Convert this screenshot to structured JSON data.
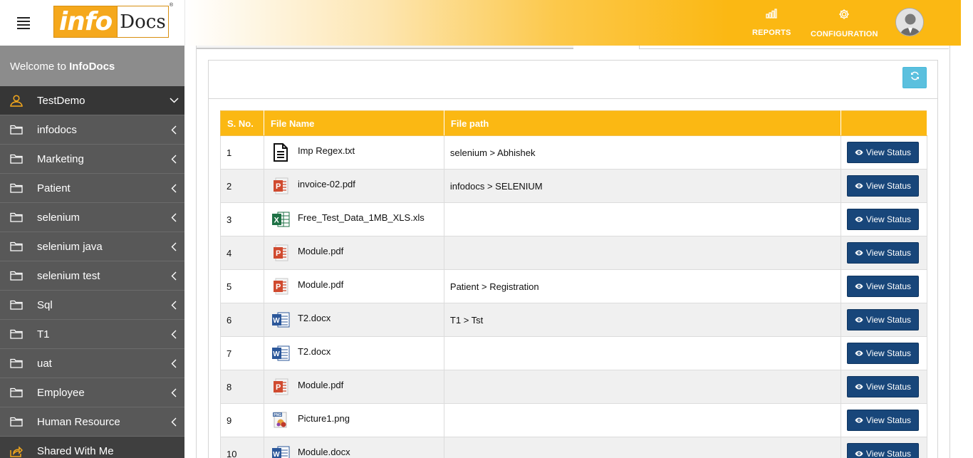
{
  "header": {
    "logo_info": "info",
    "logo_docs": "Docs",
    "logo_reg": "®",
    "reports_label": "REPORTS",
    "config_label": "CONFIGURATION"
  },
  "sidebar": {
    "welcome_prefix": "Welcome to ",
    "welcome_brand": "InfoDocs",
    "items": [
      {
        "label": "TestDemo",
        "icon": "user-icon"
      },
      {
        "label": "infodocs",
        "icon": "folder-icon"
      },
      {
        "label": "Marketing",
        "icon": "folder-icon"
      },
      {
        "label": "Patient",
        "icon": "folder-icon"
      },
      {
        "label": "selenium",
        "icon": "folder-icon"
      },
      {
        "label": "selenium java",
        "icon": "folder-icon"
      },
      {
        "label": "selenium test",
        "icon": "folder-icon"
      },
      {
        "label": "Sql",
        "icon": "folder-icon"
      },
      {
        "label": "T1",
        "icon": "folder-icon"
      },
      {
        "label": "uat",
        "icon": "folder-icon"
      },
      {
        "label": "Employee",
        "icon": "folder-icon"
      },
      {
        "label": "Human Resource",
        "icon": "folder-icon"
      },
      {
        "label": "Shared With Me",
        "icon": "share-icon"
      }
    ]
  },
  "table": {
    "headers": [
      "S. No.",
      "File Name",
      "File path",
      ""
    ],
    "action_label": "View Status",
    "rows": [
      {
        "no": "1",
        "name": "Imp Regex.txt",
        "type": "txt",
        "path": "selenium > Abhishek"
      },
      {
        "no": "2",
        "name": "invoice-02.pdf",
        "type": "pdf",
        "path": "infodocs > SELENIUM"
      },
      {
        "no": "3",
        "name": "Free_Test_Data_1MB_XLS.xls",
        "type": "xls",
        "path": ""
      },
      {
        "no": "4",
        "name": "Module.pdf",
        "type": "pdf",
        "path": ""
      },
      {
        "no": "5",
        "name": "Module.pdf",
        "type": "pdf",
        "path": "Patient > Registration"
      },
      {
        "no": "6",
        "name": "T2.docx",
        "type": "docx",
        "path": "T1 > Tst"
      },
      {
        "no": "7",
        "name": "T2.docx",
        "type": "docx",
        "path": ""
      },
      {
        "no": "8",
        "name": "Module.pdf",
        "type": "pdf",
        "path": ""
      },
      {
        "no": "9",
        "name": "Picture1.png",
        "type": "png",
        "path": ""
      },
      {
        "no": "10",
        "name": "Module.docx",
        "type": "docx",
        "path": ""
      }
    ]
  },
  "colors": {
    "accent": "#fbb813",
    "sidebar": "#585858",
    "button": "#18467a",
    "refresh": "#5bc0de"
  }
}
